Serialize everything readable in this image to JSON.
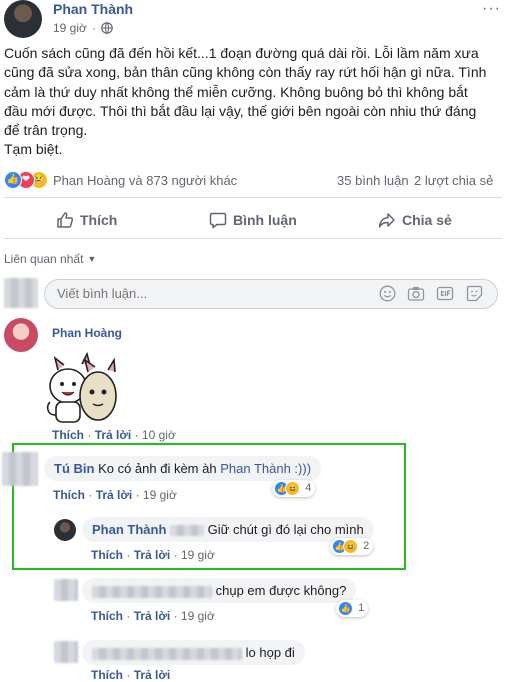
{
  "post": {
    "author": "Phan Thành",
    "time": "19 giờ",
    "content_lines": [
      "Cuốn sách cũng đã đến hồi kết...1 đoạn đường quá dài rồi. Lỗi lầm năm xưa",
      "cũng đã sửa xong, bản thân cũng không còn thấy ray rứt hối hận gì nữa. Tình",
      "cảm là thứ duy nhất không thể miễn cưỡng. Không buông bỏ thì không bắt",
      "đầu mới được. Thôi thì bắt đầu lại vậy, thế giới bên ngoài còn nhiu thứ đáng",
      "để trân trọng.",
      "Tạm biệt."
    ]
  },
  "stats": {
    "reactions_text": "Phan Hoàng và 873 người khác",
    "comments_count": "35 bình luận",
    "shares_count": "2 lượt chia sẻ"
  },
  "actions": {
    "like": "Thích",
    "comment": "Bình luận",
    "share": "Chia sẻ"
  },
  "sort_label": "Liên quan nhất",
  "comment_input": {
    "placeholder": "Viết bình luận..."
  },
  "comments": [
    {
      "author": "Phan Hoàng",
      "like": "Thích",
      "reply": "Trả lời",
      "time": "10 giờ"
    },
    {
      "author": "Tú Bin",
      "text": "Ko có ảnh đi kèm àh",
      "mention": "Phan Thành :)))",
      "like": "Thích",
      "reply": "Trả lời",
      "time": "19 giờ",
      "reaction_count": "4"
    },
    {
      "author": "Phan Thành",
      "text": "Giữ chút gì đó lại cho mình",
      "like": "Thích",
      "reply": "Trả lời",
      "time": "19 giờ",
      "reaction_count": "2"
    },
    {
      "text": "chụp em được không?",
      "like": "Thích",
      "reply": "Trả lời",
      "time": "19 giờ",
      "reaction_count": "1"
    },
    {
      "text": "lo họp đi",
      "like": "Thích",
      "reply": "Trả lời"
    }
  ],
  "colors": {
    "link": "#385898",
    "highlight_border": "#1fbf1f",
    "like_blue": "#2d88ff",
    "love_red": "#f33e58"
  },
  "icons": [
    "globe-icon",
    "chevron-down-icon",
    "like-thumb-icon",
    "comment-bubble-icon",
    "share-arrow-icon",
    "emoji-icon",
    "camera-icon",
    "gif-icon",
    "sticker-icon"
  ]
}
